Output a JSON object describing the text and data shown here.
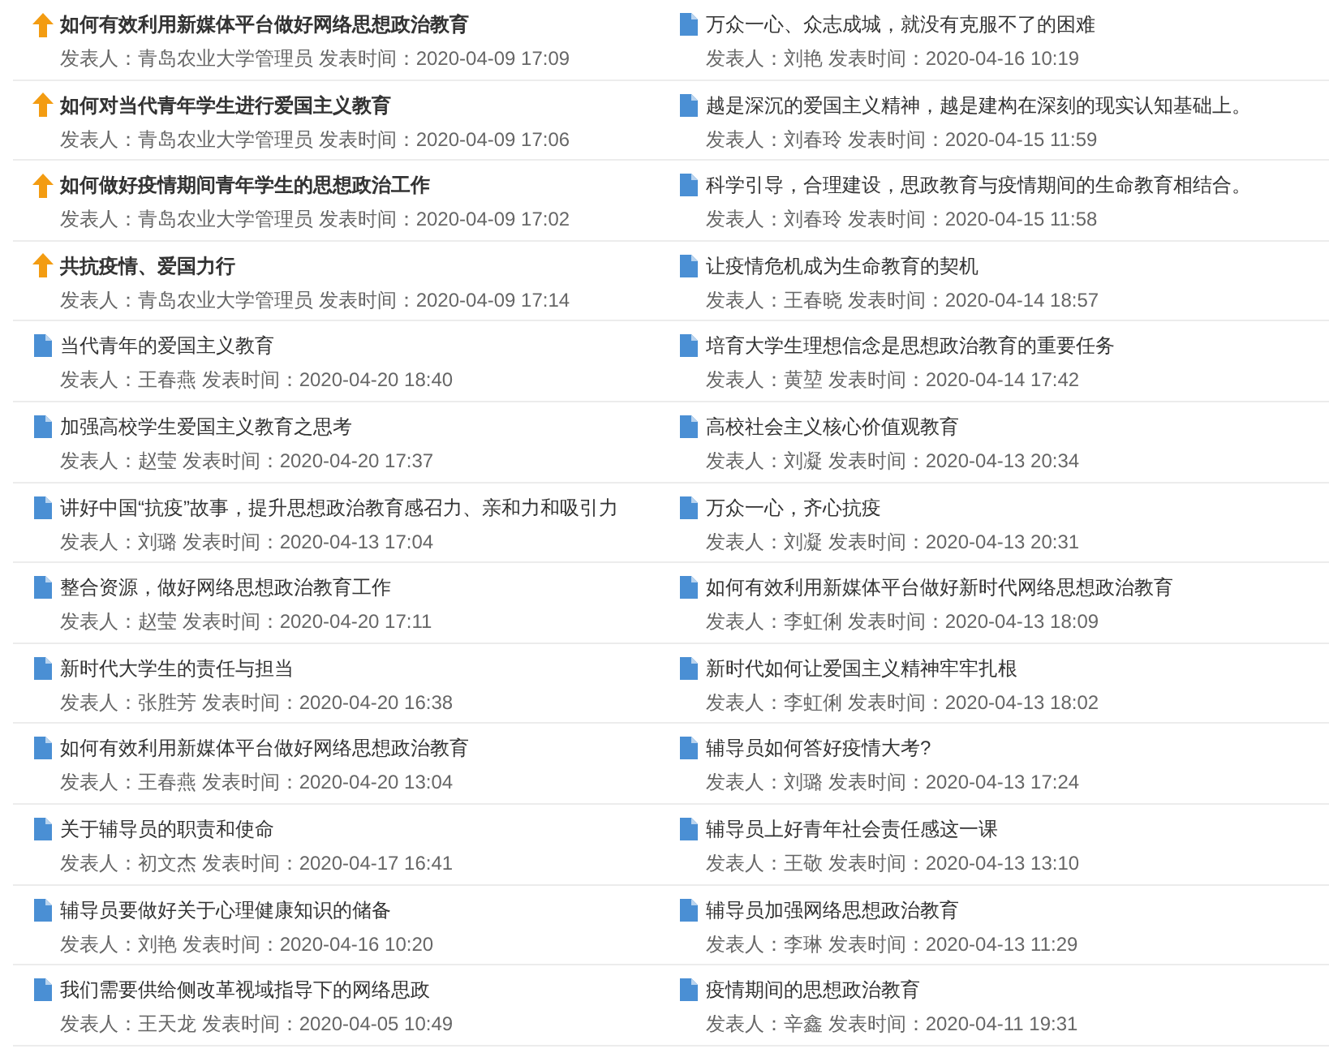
{
  "columns": [
    {
      "items": [
        {
          "kind": "pinned",
          "title": "如何有效利用新媒体平台做好网络思想政治教育",
          "meta": "发表人：青岛农业大学管理员 发表时间：2020-04-09 17:09"
        },
        {
          "kind": "pinned",
          "title": "如何对当代青年学生进行爱国主义教育",
          "meta": "发表人：青岛农业大学管理员 发表时间：2020-04-09 17:06"
        },
        {
          "kind": "pinned",
          "title": "如何做好疫情期间青年学生的思想政治工作",
          "meta": "发表人：青岛农业大学管理员 发表时间：2020-04-09 17:02"
        },
        {
          "kind": "pinned",
          "title": "共抗疫情、爱国力行",
          "meta": "发表人：青岛农业大学管理员 发表时间：2020-04-09 17:14"
        },
        {
          "kind": "doc",
          "title": "当代青年的爱国主义教育",
          "meta": "发表人：王春燕 发表时间：2020-04-20 18:40"
        },
        {
          "kind": "doc",
          "title": "加强高校学生爱国主义教育之思考",
          "meta": "发表人：赵莹 发表时间：2020-04-20 17:37"
        },
        {
          "kind": "doc",
          "title": "讲好中国“抗疫”故事，提升思想政治教育感召力、亲和力和吸引力",
          "meta": "发表人：刘璐 发表时间：2020-04-13 17:04"
        },
        {
          "kind": "doc",
          "title": "整合资源，做好网络思想政治教育工作",
          "meta": "发表人：赵莹 发表时间：2020-04-20 17:11"
        },
        {
          "kind": "doc",
          "title": "新时代大学生的责任与担当",
          "meta": "发表人：张胜芳 发表时间：2020-04-20 16:38"
        },
        {
          "kind": "doc",
          "title": "如何有效利用新媒体平台做好网络思想政治教育",
          "meta": "发表人：王春燕 发表时间：2020-04-20 13:04"
        },
        {
          "kind": "doc",
          "title": "关于辅导员的职责和使命",
          "meta": "发表人：初文杰 发表时间：2020-04-17 16:41"
        },
        {
          "kind": "doc",
          "title": "辅导员要做好关于心理健康知识的储备",
          "meta": "发表人：刘艳 发表时间：2020-04-16 10:20"
        },
        {
          "kind": "doc",
          "title": "我们需要供给侧改革视域指导下的网络思政",
          "meta": "发表人：王天龙 发表时间：2020-04-05 10:49"
        }
      ]
    },
    {
      "items": [
        {
          "kind": "doc",
          "title": "万众一心、众志成城，就没有克服不了的困难",
          "meta": "发表人：刘艳 发表时间：2020-04-16 10:19"
        },
        {
          "kind": "doc",
          "title": "越是深沉的爱国主义精神，越是建构在深刻的现实认知基础上。",
          "meta": "发表人：刘春玲 发表时间：2020-04-15 11:59"
        },
        {
          "kind": "doc",
          "title": "科学引导，合理建设，思政教育与疫情期间的生命教育相结合。",
          "meta": "发表人：刘春玲 发表时间：2020-04-15 11:58"
        },
        {
          "kind": "doc",
          "title": "让疫情危机成为生命教育的契机",
          "meta": "发表人：王春晓 发表时间：2020-04-14 18:57"
        },
        {
          "kind": "doc",
          "title": "培育大学生理想信念是思想政治教育的重要任务",
          "meta": "发表人：黄堃 发表时间：2020-04-14 17:42"
        },
        {
          "kind": "doc",
          "title": "高校社会主义核心价值观教育",
          "meta": "发表人：刘凝 发表时间：2020-04-13 20:34"
        },
        {
          "kind": "doc",
          "title": "万众一心，齐心抗疫",
          "meta": "发表人：刘凝 发表时间：2020-04-13 20:31"
        },
        {
          "kind": "doc",
          "title": "如何有效利用新媒体平台做好新时代网络思想政治教育",
          "meta": "发表人：李虹俐 发表时间：2020-04-13 18:09"
        },
        {
          "kind": "doc",
          "title": "新时代如何让爱国主义精神牢牢扎根",
          "meta": "发表人：李虹俐 发表时间：2020-04-13 18:02"
        },
        {
          "kind": "doc",
          "title": "辅导员如何答好疫情大考?",
          "meta": "发表人：刘璐 发表时间：2020-04-13 17:24"
        },
        {
          "kind": "doc",
          "title": "辅导员上好青年社会责任感这一课",
          "meta": "发表人：王敬 发表时间：2020-04-13 13:10"
        },
        {
          "kind": "doc",
          "title": "辅导员加强网络思想政治教育",
          "meta": "发表人：李琳 发表时间：2020-04-13 11:29"
        },
        {
          "kind": "doc",
          "title": "疫情期间的思想政治教育",
          "meta": "发表人：辛鑫 发表时间：2020-04-11 19:31"
        }
      ]
    }
  ]
}
